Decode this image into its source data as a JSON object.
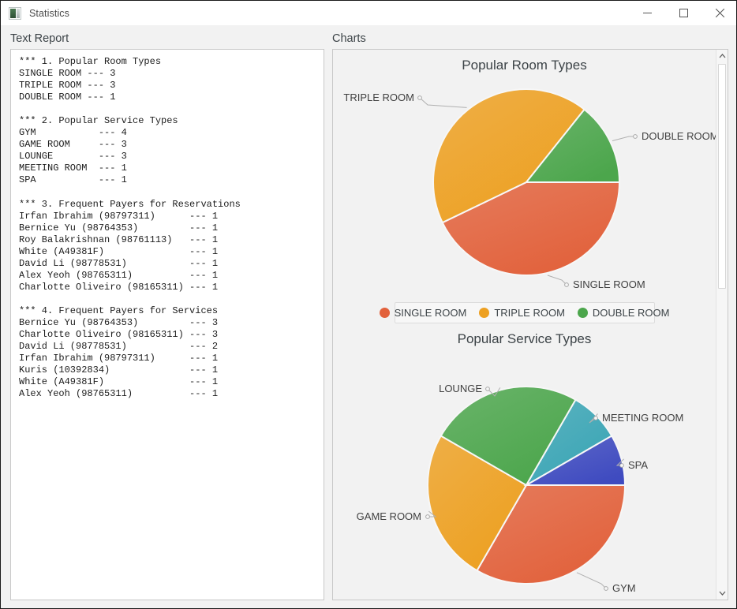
{
  "window": {
    "title": "Statistics",
    "icon": "app-icon",
    "controls": {
      "minimize": "minimize-icon",
      "maximize": "maximize-icon",
      "close": "close-icon"
    }
  },
  "panels": {
    "text_report_label": "Text Report",
    "charts_label": "Charts"
  },
  "report": {
    "text": "*** 1. Popular Room Types\nSINGLE ROOM --- 3\nTRIPLE ROOM --- 3\nDOUBLE ROOM --- 1\n\n*** 2. Popular Service Types\nGYM           --- 4\nGAME ROOM     --- 3\nLOUNGE        --- 3\nMEETING ROOM  --- 1\nSPA           --- 1\n\n*** 3. Frequent Payers for Reservations\nIrfan Ibrahim (98797311)      --- 1\nBernice Yu (98764353)         --- 1\nRoy Balakrishnan (98761113)   --- 1\nWhite (A49381F)               --- 1\nDavid Li (98778531)           --- 1\nAlex Yeoh (98765311)          --- 1\nCharlotte Oliveiro (98165311) --- 1\n\n*** 4. Frequent Payers for Services\nBernice Yu (98764353)         --- 3\nCharlotte Oliveiro (98165311) --- 3\nDavid Li (98778531)           --- 2\nIrfan Ibrahim (98797311)      --- 1\nKuris (10392834)              --- 1\nWhite (A49381F)               --- 1\nAlex Yeoh (98765311)          --- 1",
    "sections": [
      {
        "heading": "*** 1. Popular Room Types",
        "rows": [
          {
            "label": "SINGLE ROOM",
            "value": 3
          },
          {
            "label": "TRIPLE ROOM",
            "value": 3
          },
          {
            "label": "DOUBLE ROOM",
            "value": 1
          }
        ]
      },
      {
        "heading": "*** 2. Popular Service Types",
        "rows": [
          {
            "label": "GYM",
            "value": 4
          },
          {
            "label": "GAME ROOM",
            "value": 3
          },
          {
            "label": "LOUNGE",
            "value": 3
          },
          {
            "label": "MEETING ROOM",
            "value": 1
          },
          {
            "label": "SPA",
            "value": 1
          }
        ]
      },
      {
        "heading": "*** 3. Frequent Payers for Reservations",
        "rows": [
          {
            "label": "Irfan Ibrahim (98797311)",
            "value": 1
          },
          {
            "label": "Bernice Yu (98764353)",
            "value": 1
          },
          {
            "label": "Roy Balakrishnan (98761113)",
            "value": 1
          },
          {
            "label": "White (A49381F)",
            "value": 1
          },
          {
            "label": "David Li (98778531)",
            "value": 1
          },
          {
            "label": "Alex Yeoh (98765311)",
            "value": 1
          },
          {
            "label": "Charlotte Oliveiro (98165311)",
            "value": 1
          }
        ]
      },
      {
        "heading": "*** 4. Frequent Payers for Services",
        "rows": [
          {
            "label": "Bernice Yu (98764353)",
            "value": 3
          },
          {
            "label": "Charlotte Oliveiro (98165311)",
            "value": 3
          },
          {
            "label": "David Li (98778531)",
            "value": 2
          },
          {
            "label": "Irfan Ibrahim (98797311)",
            "value": 1
          },
          {
            "label": "Kuris (10392834)",
            "value": 1
          },
          {
            "label": "White (A49381F)",
            "value": 1
          },
          {
            "label": "Alex Yeoh (98765311)",
            "value": 1
          }
        ]
      }
    ]
  },
  "scrollbar": {
    "up_arrow": "chevron-up-icon",
    "down_arrow": "chevron-down-icon"
  },
  "chart_data": [
    {
      "type": "pie",
      "title": "Popular Room Types",
      "categories": [
        "SINGLE ROOM",
        "TRIPLE ROOM",
        "DOUBLE ROOM"
      ],
      "values": [
        3,
        3,
        1
      ],
      "colors": [
        "#E2613B",
        "#EDA021",
        "#4CA64C"
      ],
      "legend_position": "bottom",
      "legend": [
        "SINGLE ROOM",
        "TRIPLE ROOM",
        "DOUBLE ROOM"
      ],
      "labels_outside": true,
      "start_angle": 0
    },
    {
      "type": "pie",
      "title": "Popular Service Types",
      "categories": [
        "GYM",
        "GAME ROOM",
        "LOUNGE",
        "MEETING ROOM",
        "SPA"
      ],
      "values": [
        4,
        3,
        3,
        1,
        1
      ],
      "colors": [
        "#E2613B",
        "#EDA021",
        "#4CA64C",
        "#3AA5B5",
        "#3F4BC0"
      ],
      "legend_position": "bottom",
      "labels_outside": true,
      "start_angle": 0
    }
  ]
}
